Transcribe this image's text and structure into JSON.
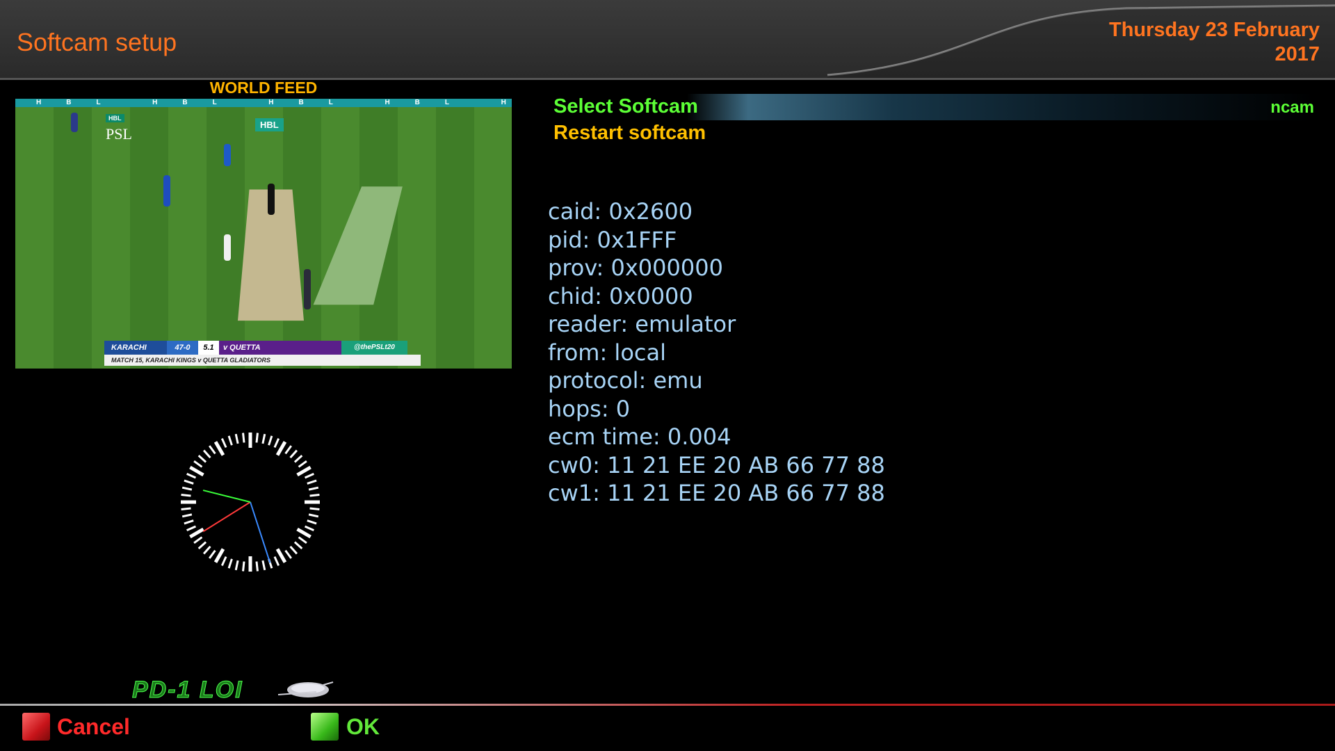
{
  "header": {
    "title": "Softcam setup",
    "date_line1": "Thursday 23 February",
    "date_line2": "2017"
  },
  "preview": {
    "label": "WORLD FEED",
    "ad_text": "HBL HBL HBL HBL HBL HBL HBL HBL HBL HBL",
    "psl_badge": "HBL",
    "psl_logo": "PSL",
    "board_text": "HBL",
    "score": {
      "team": "KARACHI",
      "runs": "47-0",
      "overs": "5.1",
      "opponent": "v QUETTA",
      "handle": "@thePSLt20",
      "subtitle": "MATCH 15, KARACHI KINGS v QUETTA GLADIATORS"
    }
  },
  "menu": {
    "items": [
      {
        "label": "Select Softcam",
        "value": "ncam",
        "selected": true
      },
      {
        "label": "Restart softcam",
        "selected": false
      }
    ]
  },
  "info": {
    "lines": [
      "caid: 0x2600",
      "pid: 0x1FFF",
      "prov: 0x000000",
      "chid: 0x0000",
      "reader: emulator",
      "from: local",
      "protocol: emu",
      "hops: 0",
      "ecm time: 0.004",
      "cw0: 11 21 EE 20 AB 66 77 88",
      "cw1: 11 21 EE 20 AB 66 77 88"
    ]
  },
  "clock": {
    "hour_hand_deg": 238,
    "minute_hand_deg": 162,
    "second_hand_deg": 284,
    "hour_color": "#ff3a3a",
    "minute_color": "#3a8aff",
    "second_color": "#3aff3a"
  },
  "logo": {
    "text": "PD-1 LOI"
  },
  "footer": {
    "cancel_label": "Cancel",
    "ok_label": "OK",
    "red": "#ff2a2a",
    "green": "#62e83a"
  },
  "colors": {
    "accent": "#ff7420",
    "menu_selected": "#5cff36",
    "menu_normal": "#ffc000",
    "info_text": "#a8d4f6"
  }
}
